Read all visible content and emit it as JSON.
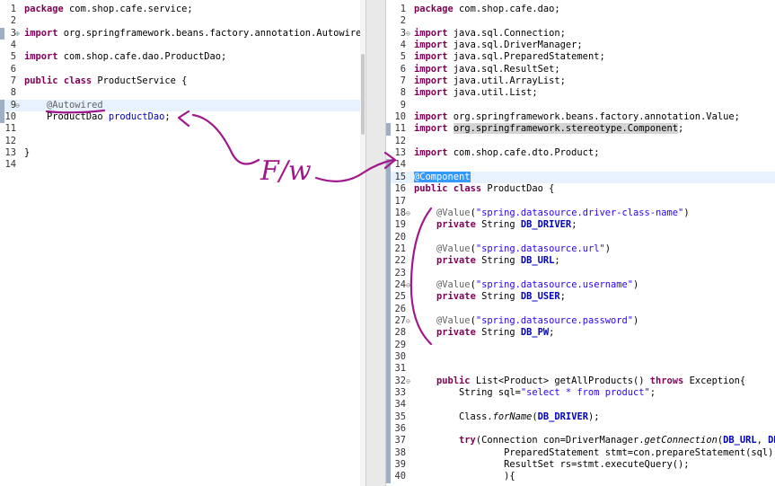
{
  "annotation": {
    "handwritten_text": "F/w"
  },
  "left_editor": {
    "lines": [
      {
        "n": "1",
        "t": "package com.shop.cafe.service;"
      },
      {
        "n": "2",
        "t": ""
      },
      {
        "n": "3",
        "t": "import org.springframework.beans.factory.annotation.Autowired;"
      },
      {
        "n": "4",
        "t": ""
      },
      {
        "n": "5",
        "t": "import com.shop.cafe.dao.ProductDao;"
      },
      {
        "n": "6",
        "t": ""
      },
      {
        "n": "7",
        "t": "public class ProductService {"
      },
      {
        "n": "8",
        "t": ""
      },
      {
        "n": "9",
        "t": "    @Autowired"
      },
      {
        "n": "10",
        "t": "    ProductDao productDao;"
      },
      {
        "n": "11",
        "t": ""
      },
      {
        "n": "12",
        "t": ""
      },
      {
        "n": "13",
        "t": "}"
      },
      {
        "n": "14",
        "t": ""
      }
    ]
  },
  "right_editor": {
    "lines": [
      {
        "n": "1",
        "t": "package com.shop.cafe.dao;"
      },
      {
        "n": "2",
        "t": ""
      },
      {
        "n": "3",
        "t": "import java.sql.Connection;"
      },
      {
        "n": "4",
        "t": "import java.sql.DriverManager;"
      },
      {
        "n": "5",
        "t": "import java.sql.PreparedStatement;"
      },
      {
        "n": "6",
        "t": "import java.sql.ResultSet;"
      },
      {
        "n": "7",
        "t": "import java.util.ArrayList;"
      },
      {
        "n": "8",
        "t": "import java.util.List;"
      },
      {
        "n": "9",
        "t": ""
      },
      {
        "n": "10",
        "t": "import org.springframework.beans.factory.annotation.Value;"
      },
      {
        "n": "11",
        "t": "import org.springframework.stereotype.Component;"
      },
      {
        "n": "12",
        "t": ""
      },
      {
        "n": "13",
        "t": "import com.shop.cafe.dto.Product;"
      },
      {
        "n": "14",
        "t": ""
      },
      {
        "n": "15",
        "t": "@Component"
      },
      {
        "n": "16",
        "t": "public class ProductDao {"
      },
      {
        "n": "17",
        "t": ""
      },
      {
        "n": "18",
        "t": "    @Value(\"spring.datasource.driver-class-name\")"
      },
      {
        "n": "19",
        "t": "    private String DB_DRIVER;"
      },
      {
        "n": "20",
        "t": ""
      },
      {
        "n": "21",
        "t": "    @Value(\"spring.datasource.url\")"
      },
      {
        "n": "22",
        "t": "    private String DB_URL;"
      },
      {
        "n": "23",
        "t": ""
      },
      {
        "n": "24",
        "t": "    @Value(\"spring.datasource.username\")"
      },
      {
        "n": "25",
        "t": "    private String DB_USER;"
      },
      {
        "n": "26",
        "t": ""
      },
      {
        "n": "27",
        "t": "    @Value(\"spring.datasource.password\")"
      },
      {
        "n": "28",
        "t": "    private String DB_PW;"
      },
      {
        "n": "29",
        "t": ""
      },
      {
        "n": "30",
        "t": ""
      },
      {
        "n": "31",
        "t": ""
      },
      {
        "n": "32",
        "t": "    public List<Product> getAllProducts() throws Exception{"
      },
      {
        "n": "33",
        "t": "        String sql=\"select * from product\";"
      },
      {
        "n": "34",
        "t": ""
      },
      {
        "n": "35",
        "t": "        Class.forName(DB_DRIVER);"
      },
      {
        "n": "36",
        "t": ""
      },
      {
        "n": "37",
        "t": "        try(Connection con=DriverManager.getConnection(DB_URL, DB_USER, DB_PW);"
      },
      {
        "n": "38",
        "t": "                PreparedStatement stmt=con.prepareStatement(sql);"
      },
      {
        "n": "39",
        "t": "                ResultSet rs=stmt.executeQuery();"
      },
      {
        "n": "40",
        "t": "                ){"
      }
    ]
  },
  "colors": {
    "keyword": "#7f0055",
    "string": "#2a00ff",
    "annotation": "#646464",
    "field": "#0000c0",
    "current_line": "#e8f2fe",
    "ink": "#a0188c"
  }
}
